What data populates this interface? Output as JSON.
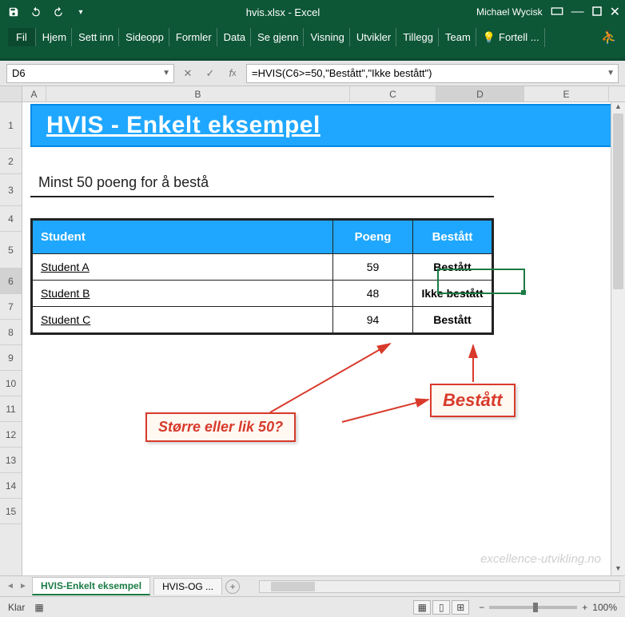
{
  "titlebar": {
    "filename": "hvis.xlsx  -  Excel",
    "user": "Michael Wycisk"
  },
  "ribbon": {
    "fil": "Fil",
    "tabs": [
      "Hjem",
      "Sett inn",
      "Sideopp",
      "Formler",
      "Data",
      "Se gjenn",
      "Visning",
      "Utvikler",
      "Tillegg",
      "Team"
    ],
    "tellme": "Fortell ..."
  },
  "namebox": "D6",
  "formula": "=HVIS(C6>=50,\"Bestått\",\"Ikke bestått\")",
  "columns": [
    "A",
    "B",
    "C",
    "D",
    "E"
  ],
  "rows": [
    "1",
    "2",
    "3",
    "4",
    "5",
    "6",
    "7",
    "8",
    "9",
    "10",
    "11",
    "12",
    "13",
    "14",
    "15"
  ],
  "content": {
    "banner": "HVIS - Enkelt eksempel",
    "subtitle": "Minst 50 poeng for å bestå",
    "headers": {
      "student": "Student",
      "poeng": "Poeng",
      "bestatt": "Bestått"
    },
    "rows": [
      {
        "student": "Student A",
        "poeng": "59",
        "result": "Bestått"
      },
      {
        "student": "Student B",
        "poeng": "48",
        "result": "Ikke bestått"
      },
      {
        "student": "Student C",
        "poeng": "94",
        "result": "Bestått"
      }
    ]
  },
  "annotations": {
    "q": "Større eller lik 50?",
    "r": "Bestått"
  },
  "watermark": "excellence-utvikling.no",
  "sheettabs": {
    "active": "HVIS-Enkelt eksempel",
    "other": "HVIS-OG ...",
    "add_tip": "+"
  },
  "statusbar": {
    "ready": "Klar",
    "zoom": "100%"
  },
  "chart_data": {
    "type": "table",
    "title": "HVIS - Enkelt eksempel",
    "columns": [
      "Student",
      "Poeng",
      "Bestått"
    ],
    "rows": [
      [
        "Student A",
        59,
        "Bestått"
      ],
      [
        "Student B",
        48,
        "Ikke bestått"
      ],
      [
        "Student C",
        94,
        "Bestått"
      ]
    ],
    "condition": "Poeng >= 50"
  }
}
